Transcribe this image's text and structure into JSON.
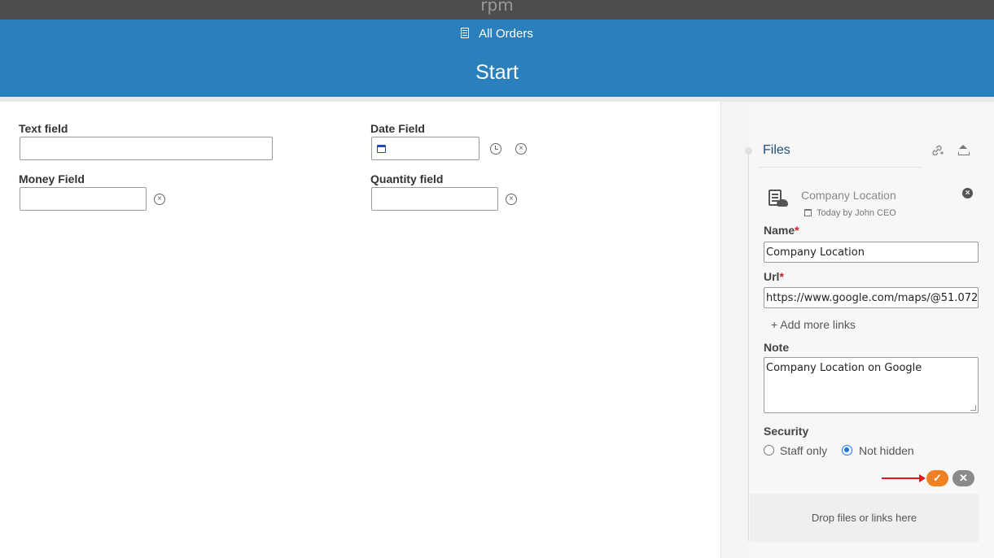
{
  "brand": "rpm",
  "header": {
    "breadcrumb": "All Orders",
    "title": "Start"
  },
  "form": {
    "text_field_label": "Text field",
    "text_field_value": "",
    "date_field_label": "Date Field",
    "date_field_value": "",
    "money_field_label": "Money Field",
    "money_field_value": "",
    "quantity_field_label": "Quantity field",
    "quantity_field_value": ""
  },
  "files": {
    "title": "Files",
    "item": {
      "name": "Company Location",
      "date": "Today",
      "author": "by John CEO"
    },
    "name_label": "Name",
    "name_value": "Company Location",
    "url_label": "Url",
    "url_value": "https://www.google.com/maps/@51.072",
    "add_links": "+ Add more links",
    "note_label": "Note",
    "note_value": "Company Location on Google",
    "security_label": "Security",
    "security_options": [
      "Staff only",
      "Not hidden"
    ],
    "security_selected": "Not hidden",
    "ok_icon": "✓",
    "cancel_icon": "✕",
    "dropzone": "Drop files or links here"
  },
  "colors": {
    "header": "#2a80bd",
    "topbar": "#4d4d50",
    "ok": "#f08022",
    "cancel": "#8a8a8a",
    "annotation_arrow": "#e0141c"
  }
}
